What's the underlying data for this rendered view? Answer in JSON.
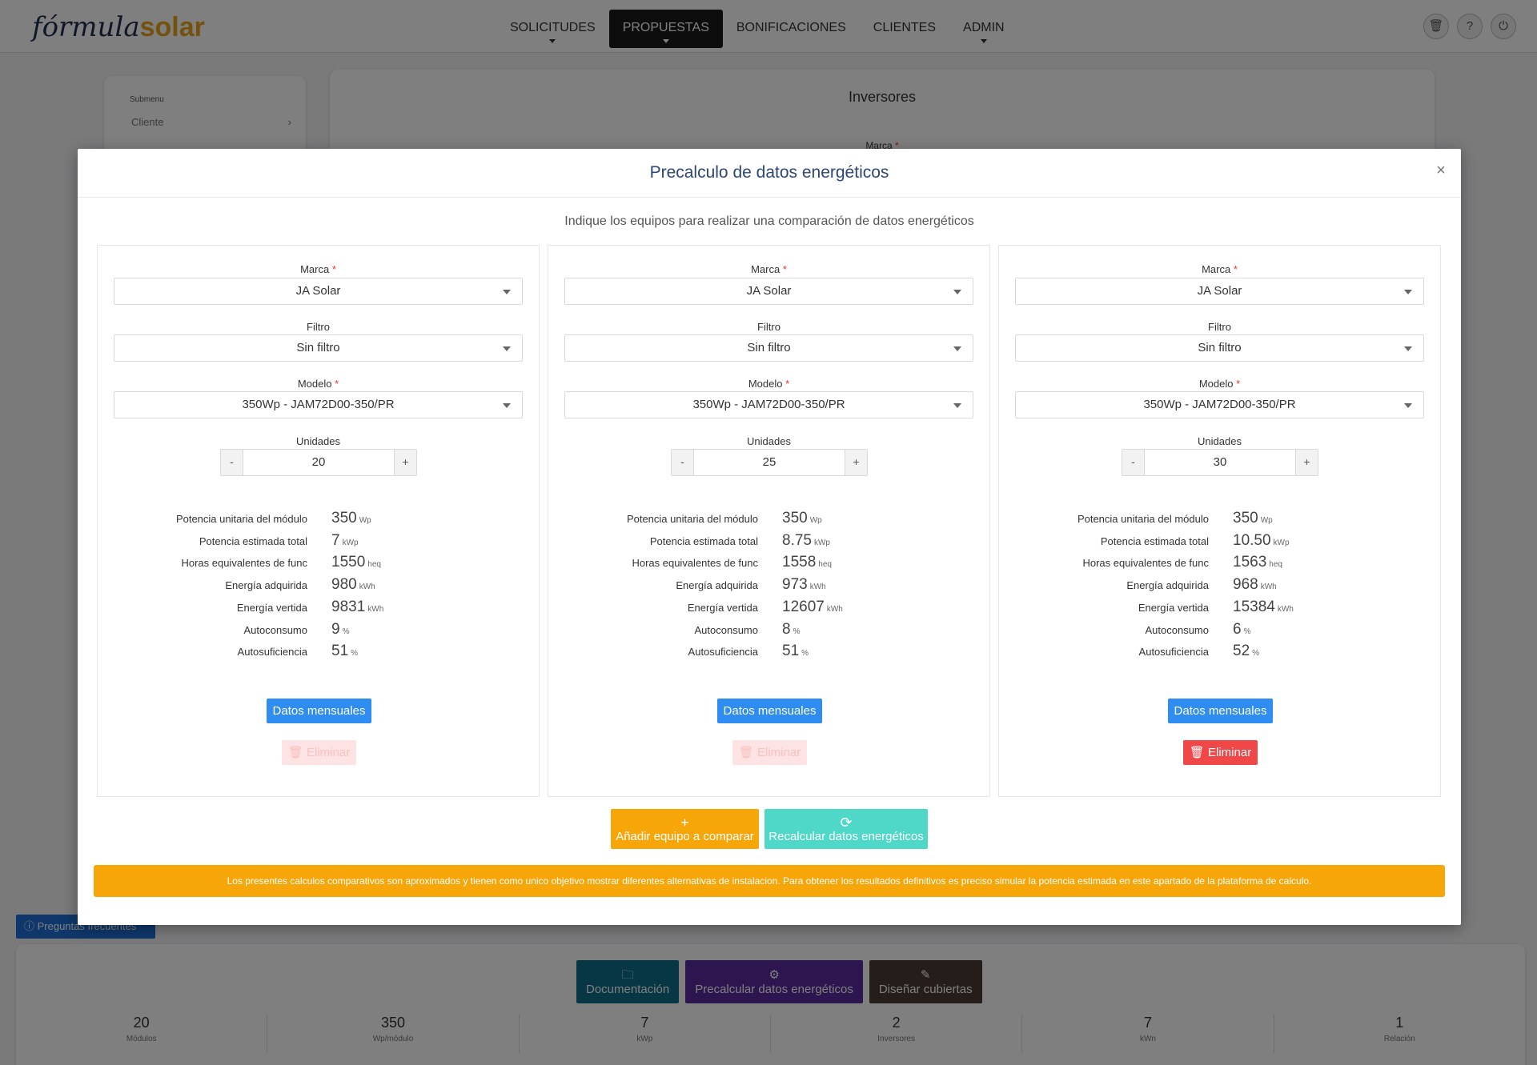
{
  "header": {
    "logo_main": "fórmula",
    "logo_accent": "solar",
    "nav": [
      {
        "label": "SOLICITUDES"
      },
      {
        "label": "PROPUESTAS"
      },
      {
        "label": "BONIFICACIONES"
      },
      {
        "label": "CLIENTES"
      },
      {
        "label": "ADMIN"
      }
    ],
    "icons": {
      "trash": "🗑",
      "help": "?",
      "power": "⏻"
    }
  },
  "background": {
    "submenu_title": "Submenu",
    "submenu_item": "Cliente",
    "submenu_chevron": "›",
    "inversores_title": "Inversores",
    "inversores_marca": "Marca",
    "inversores_req": "*",
    "faq_label": "ⓘ Preguntas frecuentes",
    "bottom_buttons": [
      {
        "icon": "🗀",
        "label": "Documentación",
        "color": "#0f6f8a"
      },
      {
        "icon": "⚙",
        "label": "Precalcular datos energéticos",
        "color": "#5a2a9e"
      },
      {
        "icon": "✎",
        "label": "Diseñar cubiertas",
        "color": "#4a3b33"
      }
    ],
    "stats": [
      {
        "value": "20",
        "label": "Módulos"
      },
      {
        "value": "350",
        "label": "Wp/módulo"
      },
      {
        "value": "7",
        "label": "kWp"
      },
      {
        "value": "2",
        "label": "Inversores"
      },
      {
        "value": "7",
        "label": "kWn"
      },
      {
        "value": "1",
        "label": "Relación"
      }
    ]
  },
  "modal": {
    "title": "Precalculo de datos energéticos",
    "close": "×",
    "subtitle": "Indique los equipos para realizar una comparación de datos energéticos",
    "labels": {
      "marca": "Marca",
      "filtro": "Filtro",
      "modelo": "Modelo",
      "unidades": "Unidades",
      "required": "*",
      "minus": "-",
      "plus": "+",
      "monthly": "Datos mensuales",
      "delete": "🗑 Eliminar"
    },
    "metric_labels": [
      "Potencia unitaria del módulo",
      "Potencia estimada total",
      "Horas equivalentes de func",
      "Energía adquirida",
      "Energía vertida",
      "Autoconsumo",
      "Autosuficiencia"
    ],
    "metric_units": [
      "Wp",
      "kWp",
      "heq",
      "kWh",
      "kWh",
      "%",
      "%"
    ],
    "columns": [
      {
        "marca": "JA Solar",
        "filtro": "Sin filtro",
        "modelo": "350Wp - JAM72D00-350/PR",
        "unidades": "20",
        "values": [
          "350",
          "7",
          "1550",
          "980",
          "9831",
          "9",
          "51"
        ],
        "delete_enabled": false
      },
      {
        "marca": "JA Solar",
        "filtro": "Sin filtro",
        "modelo": "350Wp - JAM72D00-350/PR",
        "unidades": "25",
        "values": [
          "350",
          "8.75",
          "1558",
          "973",
          "12607",
          "8",
          "51"
        ],
        "delete_enabled": false
      },
      {
        "marca": "JA Solar",
        "filtro": "Sin filtro",
        "modelo": "350Wp - JAM72D00-350/PR",
        "unidades": "30",
        "values": [
          "350",
          "10.50",
          "1563",
          "968",
          "15384",
          "6",
          "52"
        ],
        "delete_enabled": true
      }
    ],
    "add_button": {
      "icon": "+",
      "label": "Añadir equipo a comparar",
      "color": "#f7a60a"
    },
    "recalc_button": {
      "icon": "⟳",
      "label": "Recalcular datos energéticos",
      "color": "#4fd8c8"
    },
    "disclaimer": "Los presentes calculos comparativos son aproximados y tienen como unico objetivo mostrar diferentes alternativas de instalacion. Para obtener los resultados definitivos es preciso simular la potencia estimada en este apartado de la plataforma de calculo."
  }
}
